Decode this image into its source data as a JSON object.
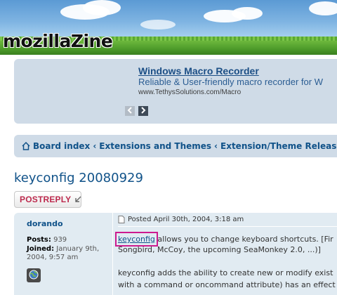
{
  "site": {
    "logo_text": "mozillaZine"
  },
  "ad": {
    "title": "Windows Macro Recorder",
    "description": "Reliable & User-friendly macro recorder for W",
    "url": "www.TethysSolutions.com/Macro",
    "prev_icon": "chevron-left-icon",
    "next_icon": "chevron-right-icon"
  },
  "breadcrumb": {
    "items": [
      {
        "label": "Board index"
      },
      {
        "label": "Extensions and Themes"
      },
      {
        "label": "Extension/Theme Releases"
      }
    ],
    "separator": "‹",
    "home_icon": "home-icon"
  },
  "topic": {
    "title": "keyconfig 20080929"
  },
  "actions": {
    "postreply_label": "POSTREPLY",
    "postreply_icon": "reply-arrow-icon"
  },
  "post": {
    "author": "dorando",
    "posts_label": "Posts:",
    "posts_value": "939",
    "joined_label": "Joined:",
    "joined_value_line1": "January 9th,",
    "joined_value_line2": "2004, 9:57 am",
    "website_icon": "globe-icon",
    "posted_text": "Posted April 30th, 2004, 3:18 am",
    "body_link": "keyconfig",
    "body_line1_rest": " allows you to change keyboard shortcuts. [Fir",
    "body_line2": "Songbird, McCoy, the upcoming SeaMonkey 2.0, ...)]",
    "body_line3": "keyconfig adds the ability to create new or modify exist",
    "body_line4": "with a command or oncommand attribute) has an effect"
  },
  "colors": {
    "link": "#105289",
    "panel_bg": "#cfdbe7",
    "post_bg": "#e1ebf2",
    "postreply_text": "#bc2a4d",
    "highlight_box": "#cc1b8f"
  }
}
